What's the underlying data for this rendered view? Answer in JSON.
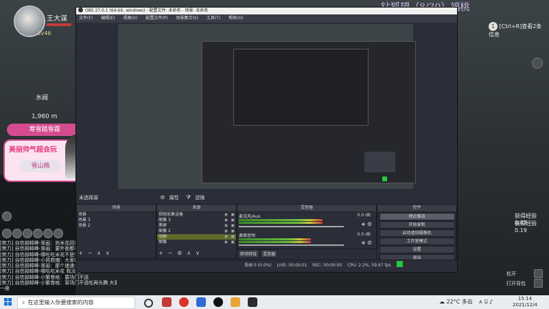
{
  "game": {
    "player_name": "王大谋",
    "level": "Lv46",
    "title": "钻狐望（8/30）福桃",
    "altitude_label": "水阀",
    "altitude_value": "1,960 m",
    "promo_banner": "寒雪踏雪霜",
    "promo_title": "美丽帅气超会玩",
    "promo_badge": "雪山格",
    "ctrl_tip": "[Ctrl+R]查看2条信息",
    "exp1": "获得经验 0.87",
    "exp2": "获得经验 0.19",
    "side_btn1": "松开",
    "side_btn2": "打开背包",
    "chat_lines": [
      "[势力] 自信部邮峰-渐画：尚米花回拿把钻外",
      "[势力] 自信部邮峰-渐画：要外面都可以",
      "[势力] 自信部邮峰-哪吃吃米花不是我",
      "[势力] 自信部邮峰-小简若喃：大家都",
      "[势力] 自信部邮峰-渐画：那个速速会",
      "[势力] 自信部邮峰-哪吃吃米花 我没啦",
      "[势力] 自信部邮峰-小繁卷格：要场门不送",
      "[势力] 自信部邮峰-小繁卷格：客场门不说吃再头腾 大家小心",
      "一座"
    ]
  },
  "obs": {
    "title": "OBS 27.0.1 (64-bit, windows) - 配置文件: 未命名 - 场景: 未命名",
    "menu": [
      "文件(F)",
      "编辑(E)",
      "视图(V)",
      "配置文件(P)",
      "场景集合(S)",
      "工具(T)",
      "帮助(H)"
    ],
    "scene_status": "未选择源",
    "properties_btn": "属性",
    "filters_btn": "滤镜",
    "panels": {
      "scenes": "场景",
      "sources": "来源",
      "mixer": "混音器",
      "controls": "控件"
    },
    "scenes": [
      "场景",
      "场景 3",
      "场景 2"
    ],
    "sources": [
      {
        "name": "视频采集设备",
        "selected": false
      },
      {
        "name": "图像 3",
        "selected": false
      },
      {
        "name": "黑屏",
        "selected": false
      },
      {
        "name": "图像 2",
        "selected": false
      },
      {
        "name": "动画",
        "selected": true
      },
      {
        "name": "图像",
        "selected": false
      }
    ],
    "mixer": [
      {
        "name": "麦克风/Aux",
        "db": "0.0 dB",
        "level": 0.72,
        "fader": 0.9
      },
      {
        "name": "桌面音频",
        "db": "0.0 dB",
        "level": 0.62,
        "fader": 0.9
      }
    ],
    "controls": [
      "停止推流",
      "开始录制",
      "启动虚拟摄像机",
      "工作室模式",
      "设置",
      "退出"
    ],
    "bottom_tabs": [
      "转场特效",
      "混音器"
    ],
    "status": {
      "dropped": "丢帧 0 (0.0%)",
      "live": "LIVE: 00:00:01",
      "rec": "REC: 00:00:00",
      "cpu": "CPU: 2.2%, 59.97 fps"
    }
  },
  "taskbar": {
    "search_placeholder": "在这里输入你要搜索的内容",
    "weather": "22°C 多云",
    "time": "15:14",
    "date": "2021/12/4"
  },
  "colors": {
    "obs_bg": "#2b2e38",
    "selected_source": "#5f6a28",
    "stream_indicator": "#28c93a",
    "promo_pink": "#d54b8f"
  }
}
